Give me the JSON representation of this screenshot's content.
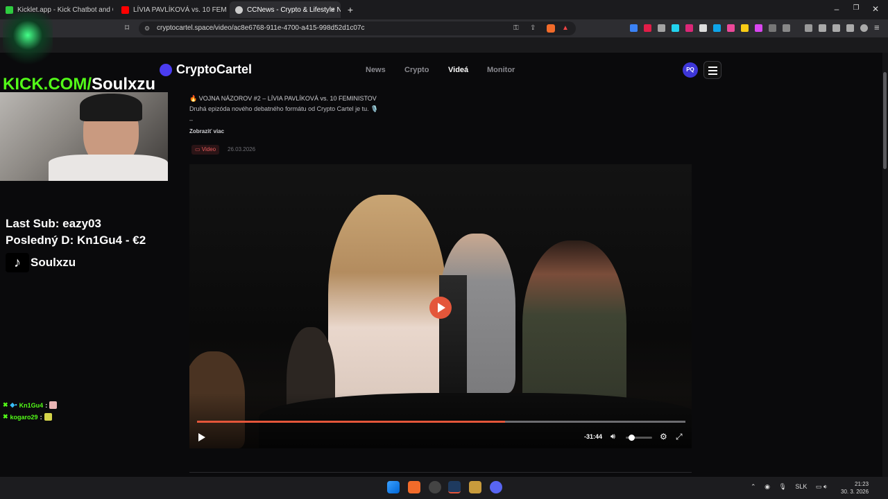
{
  "browser": {
    "tabs": [
      {
        "label": "Kicklet.app - Kick Chatbot and Overla",
        "fav_color": "#2ecc40"
      },
      {
        "label": "LÍVIA PAVLÍKOVÁ vs. 10 FEMINISTOV",
        "fav_color": "#ff0000"
      },
      {
        "label": "CCNews - Crypto & Lifestyle New",
        "fav_color": "#cccccc"
      }
    ],
    "new_tab_label": "+",
    "url": "cryptocartel.space/video/ac8e6768-911e-4700-a415-998d52d1c07c"
  },
  "site": {
    "logo_text": "CryptoCartel",
    "nav": [
      "News",
      "Crypto",
      "Videá",
      "Monitor"
    ],
    "nav_active": "Videá",
    "avatar_initials": "PQ"
  },
  "post": {
    "title": "🔥 VOJNA NÁZOROV #2 – LÍVIA PAVLÍKOVÁ vs. 10 FEMINISTOV",
    "description": "Druhá epizóda nového debatného formátu od Crypto Cartel je tu. 🎙️",
    "separator": "–",
    "show_more": "Zobraziť viac",
    "badge": "Video",
    "date": "26.03.2026"
  },
  "player": {
    "time_remaining": "-31:44",
    "progress": 0.63,
    "volume": 0.1
  },
  "overlay": {
    "kick_prefix": "KICK.COM/",
    "kick_name": "Soulxzu",
    "last_sub": "Last Sub: eazy03",
    "posledny": "Posledný D: Kn1Gu4 - €2",
    "tiktok_name": "Soulxzu",
    "chat": [
      {
        "user": "Kn1Gu4",
        "sep": ":"
      },
      {
        "user": "kogaro29",
        "sep": ":"
      }
    ]
  },
  "taskbar": {
    "lang": "SLK",
    "time": "21:23",
    "date": "30. 3. 2026"
  }
}
